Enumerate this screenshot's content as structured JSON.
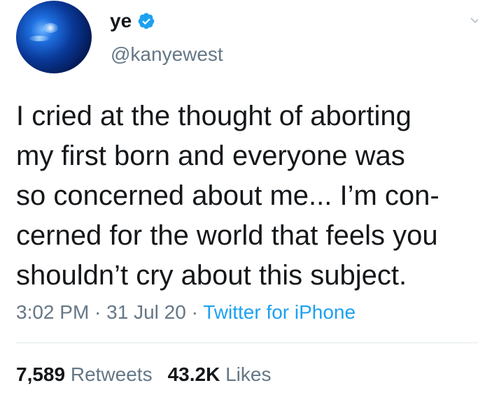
{
  "tweet": {
    "user": {
      "display_name": "ye",
      "handle": "@kanyewest",
      "verified": true,
      "avatar_icon": "avatar-image"
    },
    "text_lines": [
      "I cried at the thought of aborting",
      "my first born and everyone was",
      "so concerned about me... I’m con-",
      "cerned for the world that feels you",
      "shouldn’t cry about this subject."
    ],
    "time": "3:02 PM",
    "date": "31 Jul 20",
    "separator": " · ",
    "source": "Twitter for iPhone",
    "retweets_count": "7,589",
    "retweets_label": "Retweets",
    "likes_count": "43.2K",
    "likes_label": "Likes"
  },
  "colors": {
    "text": "#14171a",
    "secondary": "#657786",
    "link": "#1da1f2",
    "divider": "#e1e8ed"
  },
  "icons": {
    "verified": "verified-badge-icon",
    "more": "chevron-down-icon"
  }
}
